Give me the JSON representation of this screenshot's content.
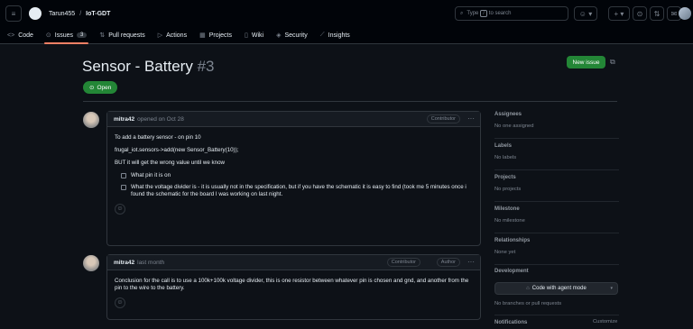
{
  "header": {
    "owner": "Tarun455",
    "separator": "/",
    "repo": "IoT-GDT",
    "search_placeholder_pre": "Type",
    "search_key": "/",
    "search_placeholder_post": "to search"
  },
  "tabs": [
    {
      "label": "Code",
      "icon": "<>"
    },
    {
      "label": "Issues",
      "icon": "⊙",
      "count": "3"
    },
    {
      "label": "Pull requests",
      "icon": "⇅"
    },
    {
      "label": "Actions",
      "icon": "▷"
    },
    {
      "label": "Projects",
      "icon": "▦"
    },
    {
      "label": "Wiki",
      "icon": "▯"
    },
    {
      "label": "Security",
      "icon": "◈"
    },
    {
      "label": "Insights",
      "icon": "⟋"
    }
  ],
  "issue": {
    "title": "Sensor - Battery",
    "number": "#3",
    "state": "Open",
    "new_issue_label": "New issue"
  },
  "comments": [
    {
      "author": "mitra42",
      "meta": "opened on Oct 28",
      "role": "Contributor",
      "body": [
        "To add a battery sensor - on pin 10",
        "frugal_iot.sensors->add(new Sensor_Battery(10));",
        "BUT it will get the wrong value until we know"
      ],
      "tasks": [
        "What pin it is on",
        "What the voltage divider is - it is usually not in the specification, but if you have the schematic it is easy to find (took me 5 minutes once i found the schematic for the board I was working on last night."
      ]
    },
    {
      "author": "mitra42",
      "meta": "last month",
      "role": "Contributor",
      "role2": "Author",
      "body": [
        "Conclusion for the call is to use a 100k+100k voltage divider, this is one resistor between whatever pin is chosen and gnd, and another from the pin to the wire to the battery."
      ]
    }
  ],
  "sidebar": {
    "assignees": {
      "label": "Assignees",
      "value": "No one assigned"
    },
    "labels": {
      "label": "Labels",
      "value": "No labels"
    },
    "projects": {
      "label": "Projects",
      "value": "No projects"
    },
    "milestone": {
      "label": "Milestone",
      "value": "No milestone"
    },
    "relationships": {
      "label": "Relationships",
      "value": "None yet"
    },
    "development": {
      "label": "Development",
      "button": "Code with agent mode",
      "value": "No branches or pull requests"
    },
    "notifications": {
      "label": "Notifications",
      "action": "Customize"
    }
  },
  "colors": {
    "accent": "#238636",
    "tab_underline": "#f78166",
    "background": "#0d1117"
  }
}
